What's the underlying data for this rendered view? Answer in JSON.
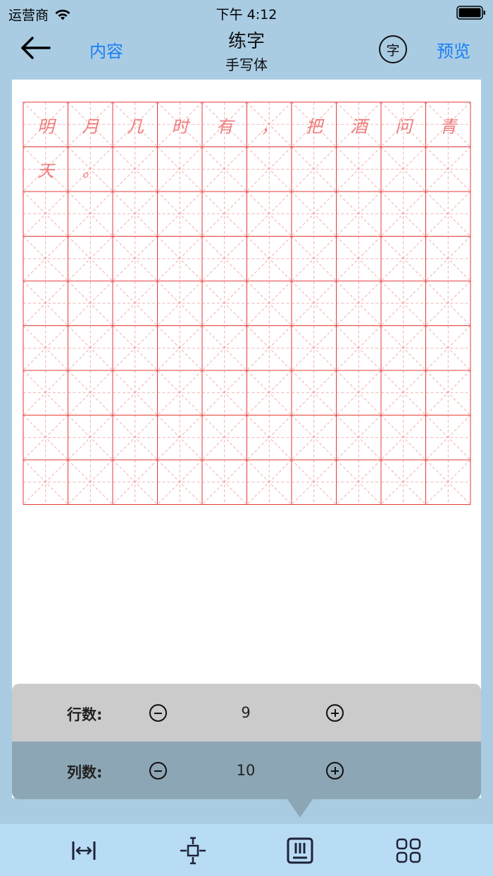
{
  "status_bar": {
    "carrier": "运营商",
    "time": "下午 4:12"
  },
  "nav": {
    "back_icon": "arrow-left-icon",
    "content_label": "内容",
    "title": "练字",
    "subtitle": "手写体",
    "font_button_label": "字",
    "preview_label": "预览"
  },
  "grid": {
    "rows": 9,
    "cols": 10,
    "line_color": "#e53935",
    "guide_color": "#f29a9a",
    "text_color": "#ef7d7d",
    "characters": [
      "明",
      "月",
      "几",
      "时",
      "有",
      "，",
      "把",
      "酒",
      "问",
      "青",
      "天",
      "。"
    ]
  },
  "settings": {
    "rows_label": "行数:",
    "rows_value": "9",
    "cols_label": "列数:",
    "cols_value": "10"
  },
  "toolbar": {
    "items": [
      {
        "icon": "width-arrows-icon"
      },
      {
        "icon": "margin-adjust-icon"
      },
      {
        "icon": "grid-layout-icon",
        "active": true
      },
      {
        "icon": "style-options-icon"
      }
    ]
  },
  "colors": {
    "background": "#a9cce3",
    "accent": "#1a7ef5",
    "toolbar": "#b8dcf3",
    "rows_panel": "#cbcbcb",
    "cols_panel": "#8da6b5"
  }
}
